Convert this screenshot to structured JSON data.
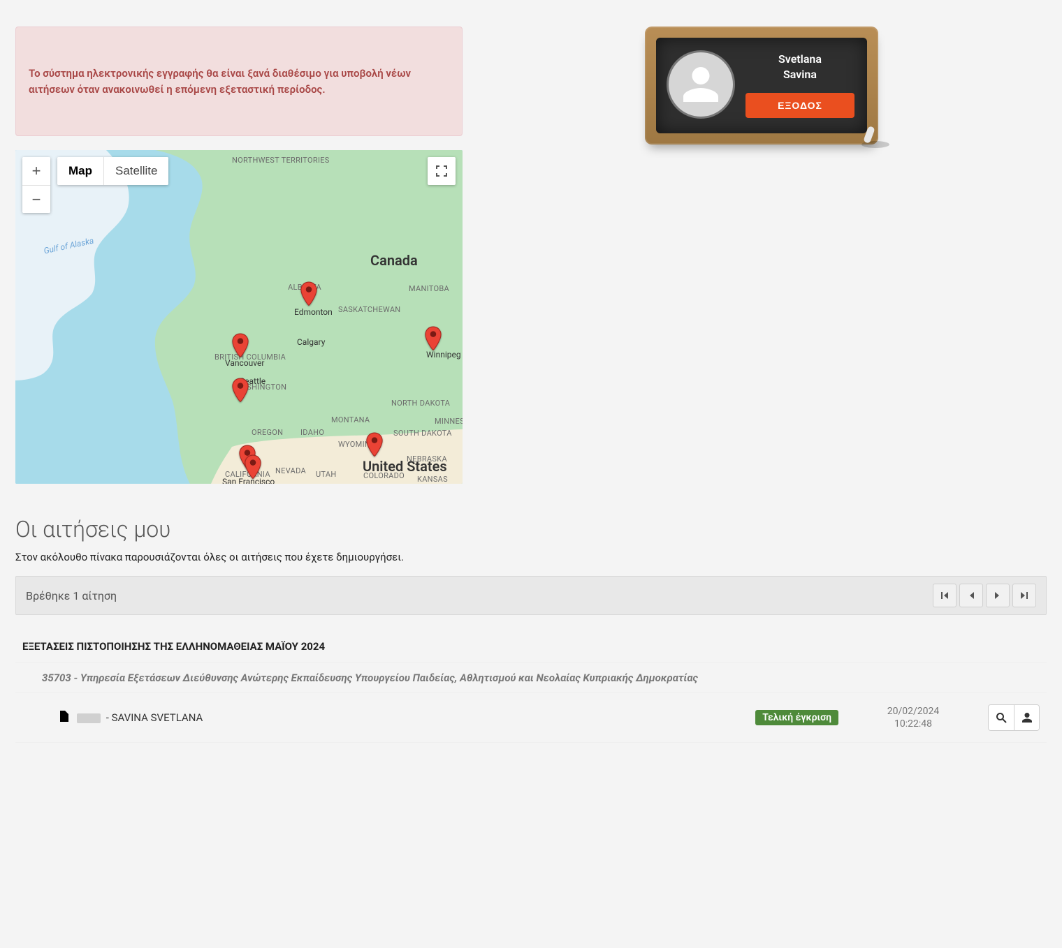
{
  "alert": {
    "message": "Το σύστημα ηλεκτρονικής εγγραφής θα είναι ξανά διαθέσιμο για υποβολή νέων αιτήσεων όταν ανακοινωθεί η επόμενη εξεταστική περίοδος."
  },
  "map": {
    "type_map_label": "Map",
    "type_satellite_label": "Satellite",
    "gulf_label": "Gulf of Alaska",
    "countries": {
      "canada": "Canada",
      "usa": "United States"
    },
    "regions": {
      "nwt": "NORTHWEST TERRITORIES",
      "bc": "BRITISH COLUMBIA",
      "alberta": "ALBERTA",
      "sask": "SASKATCHEWAN",
      "manitoba": "MANITOBA",
      "washington": "WASHINGTON",
      "oregon": "OREGON",
      "california": "CALIFORNIA",
      "nevada": "NEVADA",
      "idaho": "IDAHO",
      "montana": "MONTANA",
      "wyoming": "WYOMING",
      "utah": "UTAH",
      "colorado": "COLORADO",
      "ndakota": "NORTH DAKOTA",
      "sdakota": "SOUTH DAKOTA",
      "nebraska": "NEBRASKA",
      "kansas": "KANSAS",
      "minnesota": "MINNESOTA"
    },
    "cities": {
      "edmonton": "Edmonton",
      "calgary": "Calgary",
      "vancouver": "Vancouver",
      "seattle": "Seattle",
      "winnipeg": "Winnipeg",
      "sanfrancisco": "San Francisco"
    }
  },
  "profile": {
    "first_name": "Svetlana",
    "last_name": "Savina",
    "logout_label": "ΕΞΟΔΟΣ"
  },
  "requests": {
    "heading": "Οι αιτήσεις μου",
    "description": "Στον ακόλουθο πίνακα παρουσιάζονται όλες οι αιτήσεις που έχετε δημιουργήσει.",
    "found_text": "Βρέθηκε 1 αίτηση",
    "exam_title": "ΕΞΕΤΑΣΕΙΣ ΠΙΣΤΟΠΟΙΗΣΗΣ ΤΗΣ ΕΛΛΗΝΟΜΑΘΕΙΑΣ ΜΑΪΟΥ 2024",
    "center": "35703 - Υπηρεσία Εξετάσεων Διεύθυνσης Ανώτερης Εκπαίδευσης Υπουργείου Παιδείας, Αθλητισμού και Νεολαίας Κυπριακής Δημοκρατίας",
    "row": {
      "name_suffix": "- SAVINA SVETLANA",
      "status": "Τελική έγκριση",
      "date": "20/02/2024",
      "time": "10:22:48"
    }
  }
}
